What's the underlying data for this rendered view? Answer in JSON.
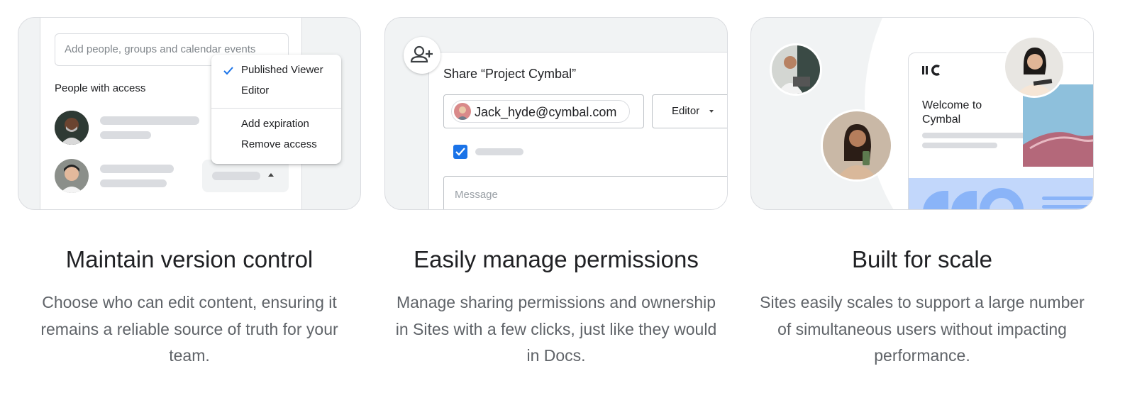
{
  "cards": {
    "version": {
      "search_placeholder": "Add people, groups and calendar events",
      "people_label": "People with access",
      "menu": {
        "items": [
          "Published Viewer",
          "Editor",
          "Add expiration",
          "Remove access"
        ],
        "checked_item": "Published Viewer"
      }
    },
    "permissions": {
      "dialog_title": "Share “Project Cymbal”",
      "email_chip": "Jack_hyde@cymbal.com",
      "role_select": "Editor",
      "notify_checked": true,
      "message_placeholder": "Message"
    },
    "scale": {
      "site_card_title": "Welcome to Cymbal"
    }
  },
  "features": [
    {
      "title": "Maintain version control",
      "description": "Choose who can edit content, ensuring it remains a reliable source of truth for your team."
    },
    {
      "title": "Easily manage permissions",
      "description": "Manage sharing permissions and ownership in Sites with a few clicks, just like they would in Docs."
    },
    {
      "title": "Built for scale",
      "description": "Sites easily scales to support a large number of simultaneous users without impacting performance."
    }
  ],
  "colors": {
    "accent_blue": "#1a73e8",
    "card_background": "#f1f3f4",
    "skeleton_gray": "#dadce0",
    "hero_light_blue": "#c2d7fb"
  }
}
